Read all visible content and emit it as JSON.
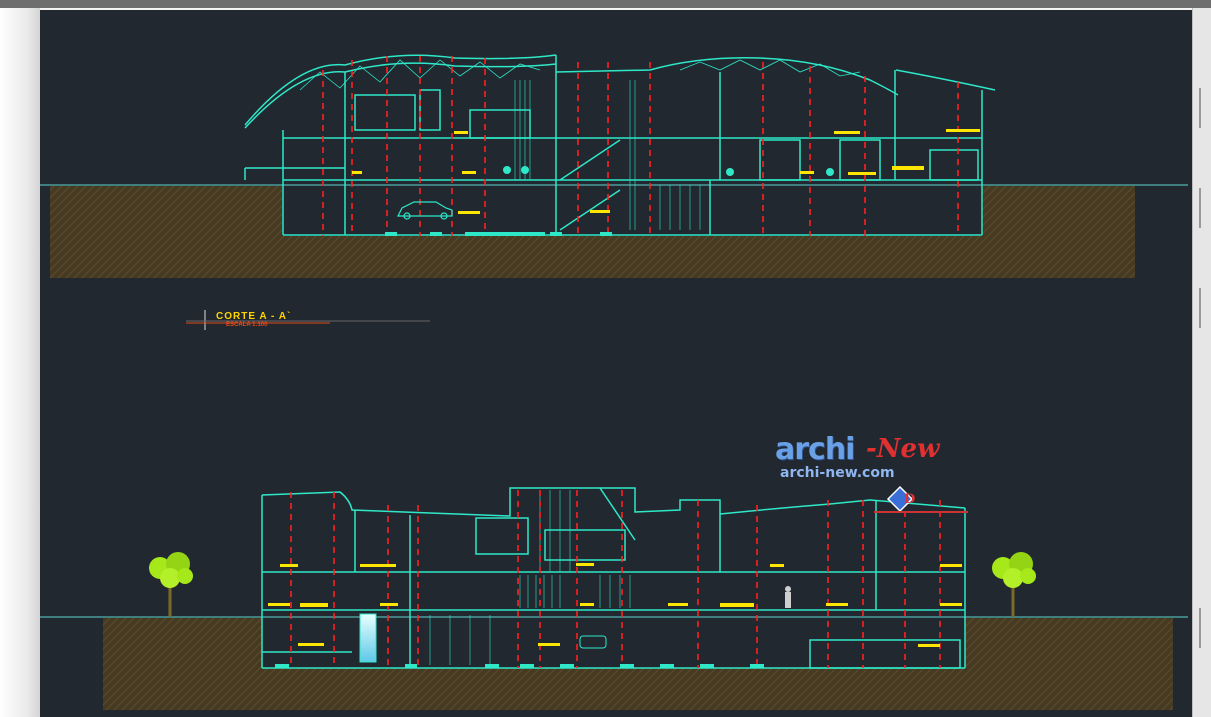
{
  "drawing": {
    "section_title": "CORTE   A - A`",
    "section_scale": "ESCALA 1:100"
  },
  "watermark": {
    "brand": "archi",
    "brand_suffix": "-New",
    "url": "archi-new.com",
    "logo_text": "D"
  },
  "colors": {
    "canvas": "#212830",
    "structure": "#2ee8c8",
    "columns": "#ff2020",
    "labels": "#ffe600",
    "soil": "#4a3d24",
    "tree": "#a6e81a",
    "ground_line": "#5fd6cf"
  },
  "icons": [
    "tree-icon",
    "car-icon",
    "person-icon",
    "logo-diamond-icon"
  ]
}
